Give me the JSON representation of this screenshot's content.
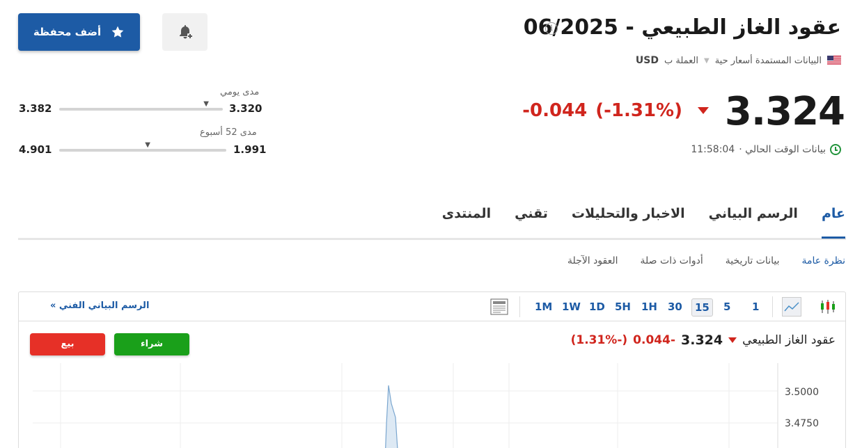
{
  "header": {
    "title": "عقود الغاز الطبيعي - 06/2025",
    "info_glyph": "i",
    "data_source": "البيانات المستمدة أسعار حية",
    "currency_label": "العملة ب",
    "currency": "USD",
    "add_portfolio_label": "أضف محفظة"
  },
  "quote": {
    "price": "3.324",
    "change": "-0.044",
    "change_pct": "(-1.31%)",
    "time_label": "بيانات الوقت الحالي ·",
    "time": "11:58:04"
  },
  "ranges": {
    "daily": {
      "label": "مدى يومي",
      "low": "3.320",
      "high": "3.382",
      "position_pct": 5
    },
    "week52": {
      "label": "مدى 52 أسبوع",
      "low": "1.991",
      "high": "4.901",
      "position_pct": 47
    }
  },
  "tabs": [
    {
      "label": "عام",
      "active": true
    },
    {
      "label": "الرسم البياني",
      "active": false
    },
    {
      "label": "الاخبار والتحليلات",
      "active": false
    },
    {
      "label": "تقني",
      "active": false
    },
    {
      "label": "المنتدى",
      "active": false
    }
  ],
  "subtabs": [
    {
      "label": "نظرة عامة",
      "active": true
    },
    {
      "label": "بيانات تاريخية",
      "active": false
    },
    {
      "label": "أدوات ذات صلة",
      "active": false
    },
    {
      "label": "العقود الآجلة",
      "active": false
    }
  ],
  "chart_widget": {
    "timeframes": [
      "1",
      "5",
      "15",
      "30",
      "1H",
      "5H",
      "1D",
      "1W",
      "1M"
    ],
    "active_timeframe": "15",
    "advanced_link": "الرسم البياني الفني »",
    "instrument_name": "عقود الغاز الطبيعي",
    "price": "3.324",
    "change": "-0.044",
    "change_pct": "(-1.31%)",
    "buy_label": "شراء",
    "sell_label": "بيع"
  },
  "chart_data": {
    "type": "area",
    "y_ticks": [
      "3.5000",
      "3.4750"
    ],
    "grid": true
  },
  "colors": {
    "brand_blue": "#1d5ba5",
    "negative": "#d0251d",
    "buy": "#1aa01a",
    "sell": "#e63027",
    "live_green": "#22943c"
  }
}
